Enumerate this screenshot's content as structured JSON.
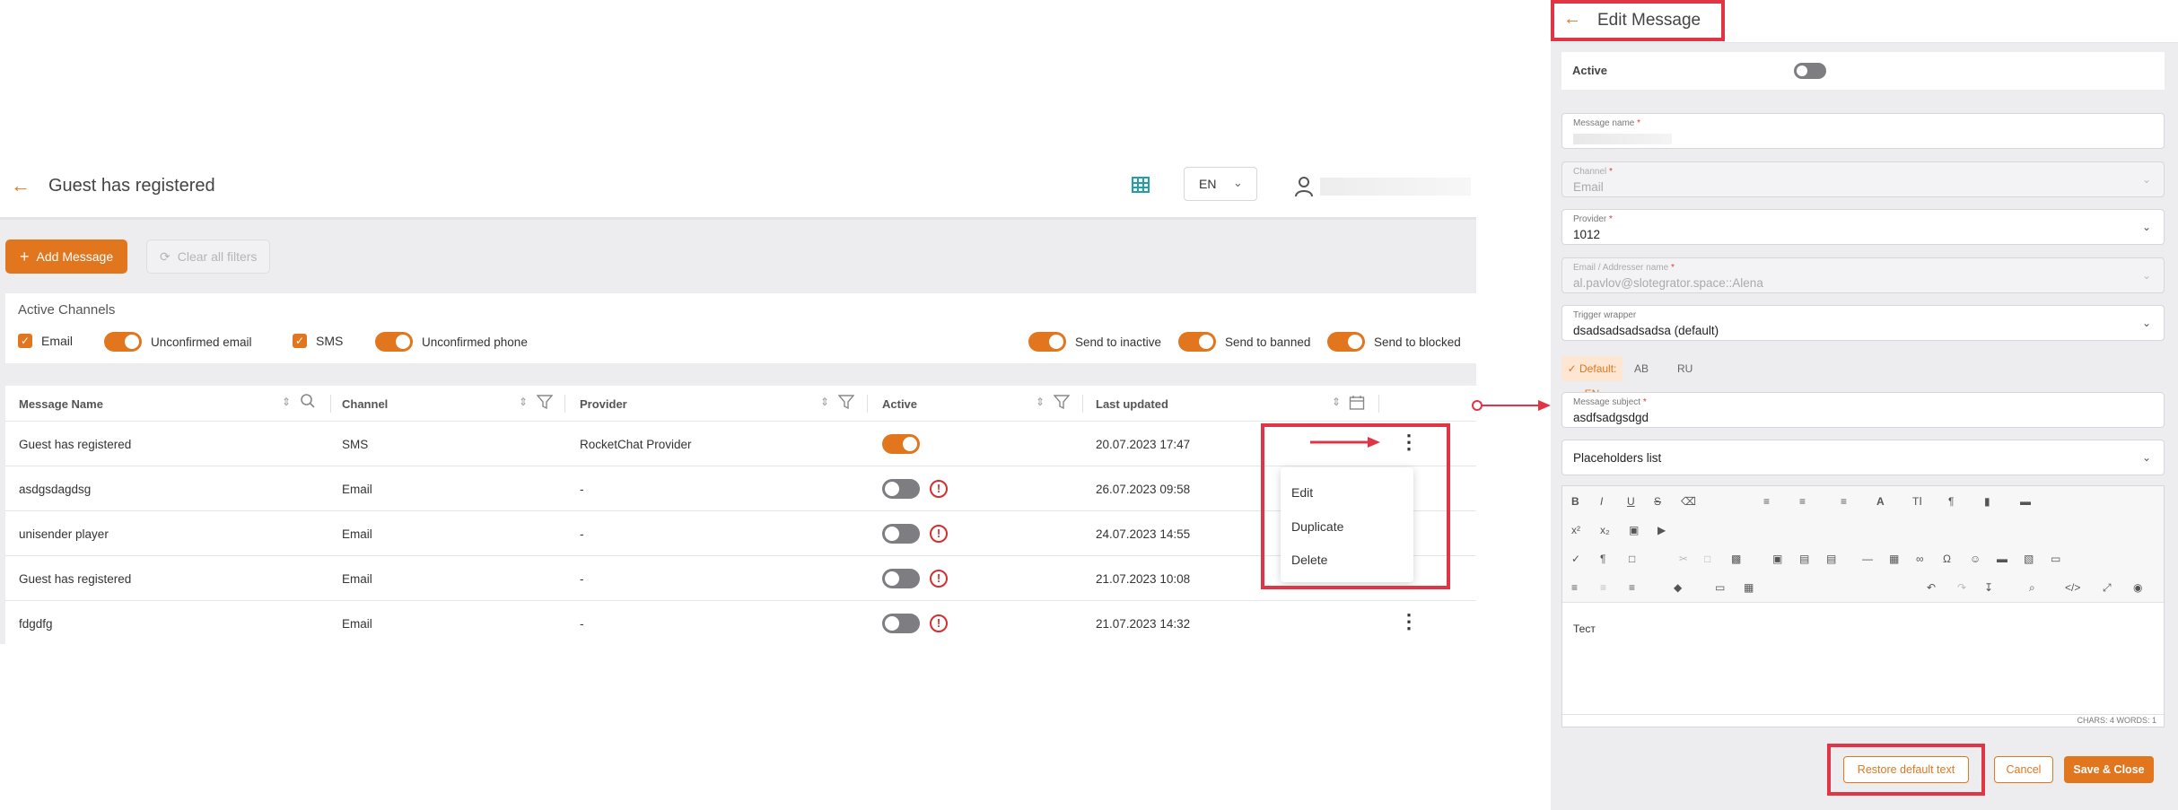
{
  "list_page": {
    "title": "Guest has registered",
    "lang": "EN",
    "add_label": "Add Message",
    "clear_label": "Clear all filters",
    "channels": {
      "heading": "Active Channels",
      "email": "Email",
      "unconfirmed_email": "Unconfirmed email",
      "sms": "SMS",
      "unconfirmed_phone": "Unconfirmed phone",
      "send_inactive": "Send to inactive",
      "send_banned": "Send to banned",
      "send_blocked": "Send to blocked"
    },
    "columns": [
      "Message Name",
      "Channel",
      "Provider",
      "Active",
      "Last updated"
    ],
    "rows": [
      {
        "name": "Guest has registered",
        "channel": "SMS",
        "provider": "RocketChat Provider",
        "active": true,
        "updated": "20.07.2023 17:47"
      },
      {
        "name": "asdgsdagdsg",
        "channel": "Email",
        "provider": "-",
        "active": false,
        "updated": "26.07.2023 09:58"
      },
      {
        "name": "unisender player",
        "channel": "Email",
        "provider": "-",
        "active": false,
        "updated": "24.07.2023 14:55"
      },
      {
        "name": "Guest has registered",
        "channel": "Email",
        "provider": "-",
        "active": false,
        "updated": "21.07.2023 10:08"
      },
      {
        "name": "fdgdfg",
        "channel": "Email",
        "provider": "-",
        "active": false,
        "updated": "21.07.2023 14:32"
      }
    ],
    "menu": [
      "Edit",
      "Duplicate",
      "Delete"
    ]
  },
  "edit_panel": {
    "title": "Edit Message",
    "active_label": "Active",
    "message_name_label": "Message name",
    "channel_label": "Channel",
    "channel_value": "Email",
    "provider_label": "Provider",
    "provider_value": "1012",
    "email_label": "Email / Addresser name",
    "email_value": "al.pavlov@slotegrator.space::Alena",
    "trigger_label": "Trigger wrapper",
    "trigger_value": "dsadsadsadsadsa (default)",
    "lang_tabs": [
      "Default: EN",
      "AB",
      "RU"
    ],
    "subject_label": "Message subject",
    "subject_value": "asdfsadgsdgd",
    "placeholders_label": "Placeholders list",
    "editor_text": "Тест",
    "stats": "CHARS: 4   WORDS: 1",
    "restore_label": "Restore default text",
    "cancel_label": "Cancel",
    "save_label": "Save & Close",
    "required_mark": "*"
  },
  "colors": {
    "accent": "#e2761f",
    "highlight": "#e03545"
  },
  "icons": [
    "back-arrow-icon",
    "layout-icon",
    "chevron-down-icon",
    "user-icon",
    "plus-icon",
    "filter-reset-icon",
    "sort-icon",
    "search-icon",
    "filter-icon",
    "calendar-icon",
    "kebab-icon",
    "alert-icon",
    "checkmark-icon"
  ]
}
